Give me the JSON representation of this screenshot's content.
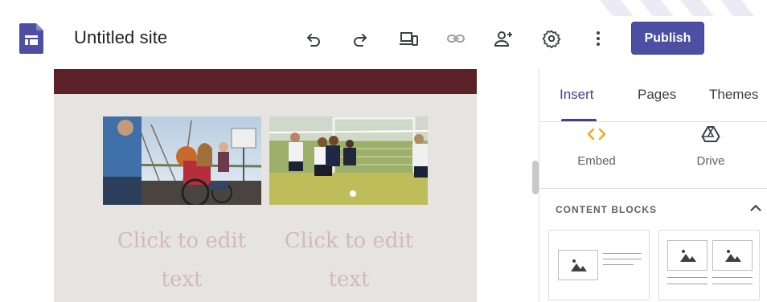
{
  "app": {
    "title": "Untitled site",
    "brand_color": "#4d4fa3",
    "logo_icon": "google-sites-logo"
  },
  "toolbar": {
    "items": [
      {
        "name": "undo-icon"
      },
      {
        "name": "redo-icon"
      },
      {
        "name": "preview-devices-icon"
      },
      {
        "name": "link-icon"
      },
      {
        "name": "share-add-person-icon"
      },
      {
        "name": "settings-gear-icon"
      },
      {
        "name": "more-vert-icon"
      }
    ],
    "publish_label": "Publish"
  },
  "canvas": {
    "header_color": "#5a2228",
    "background_color": "#e6e4e1",
    "images": [
      {
        "name": "wheelchair-basketball-photo"
      },
      {
        "name": "kids-soccer-photo"
      }
    ],
    "placeholders": [
      "Click to edit text",
      "Click to edit text"
    ]
  },
  "panel": {
    "tabs": [
      {
        "label": "Insert",
        "active": true
      },
      {
        "label": "Pages",
        "active": false
      },
      {
        "label": "Themes",
        "active": false
      }
    ],
    "insert_items": [
      {
        "label": "Embed",
        "icon": "embed-code-icon"
      },
      {
        "label": "Drive",
        "icon": "google-drive-icon"
      }
    ],
    "content_blocks": {
      "title": "CONTENT BLOCKS",
      "expanded": true
    }
  }
}
